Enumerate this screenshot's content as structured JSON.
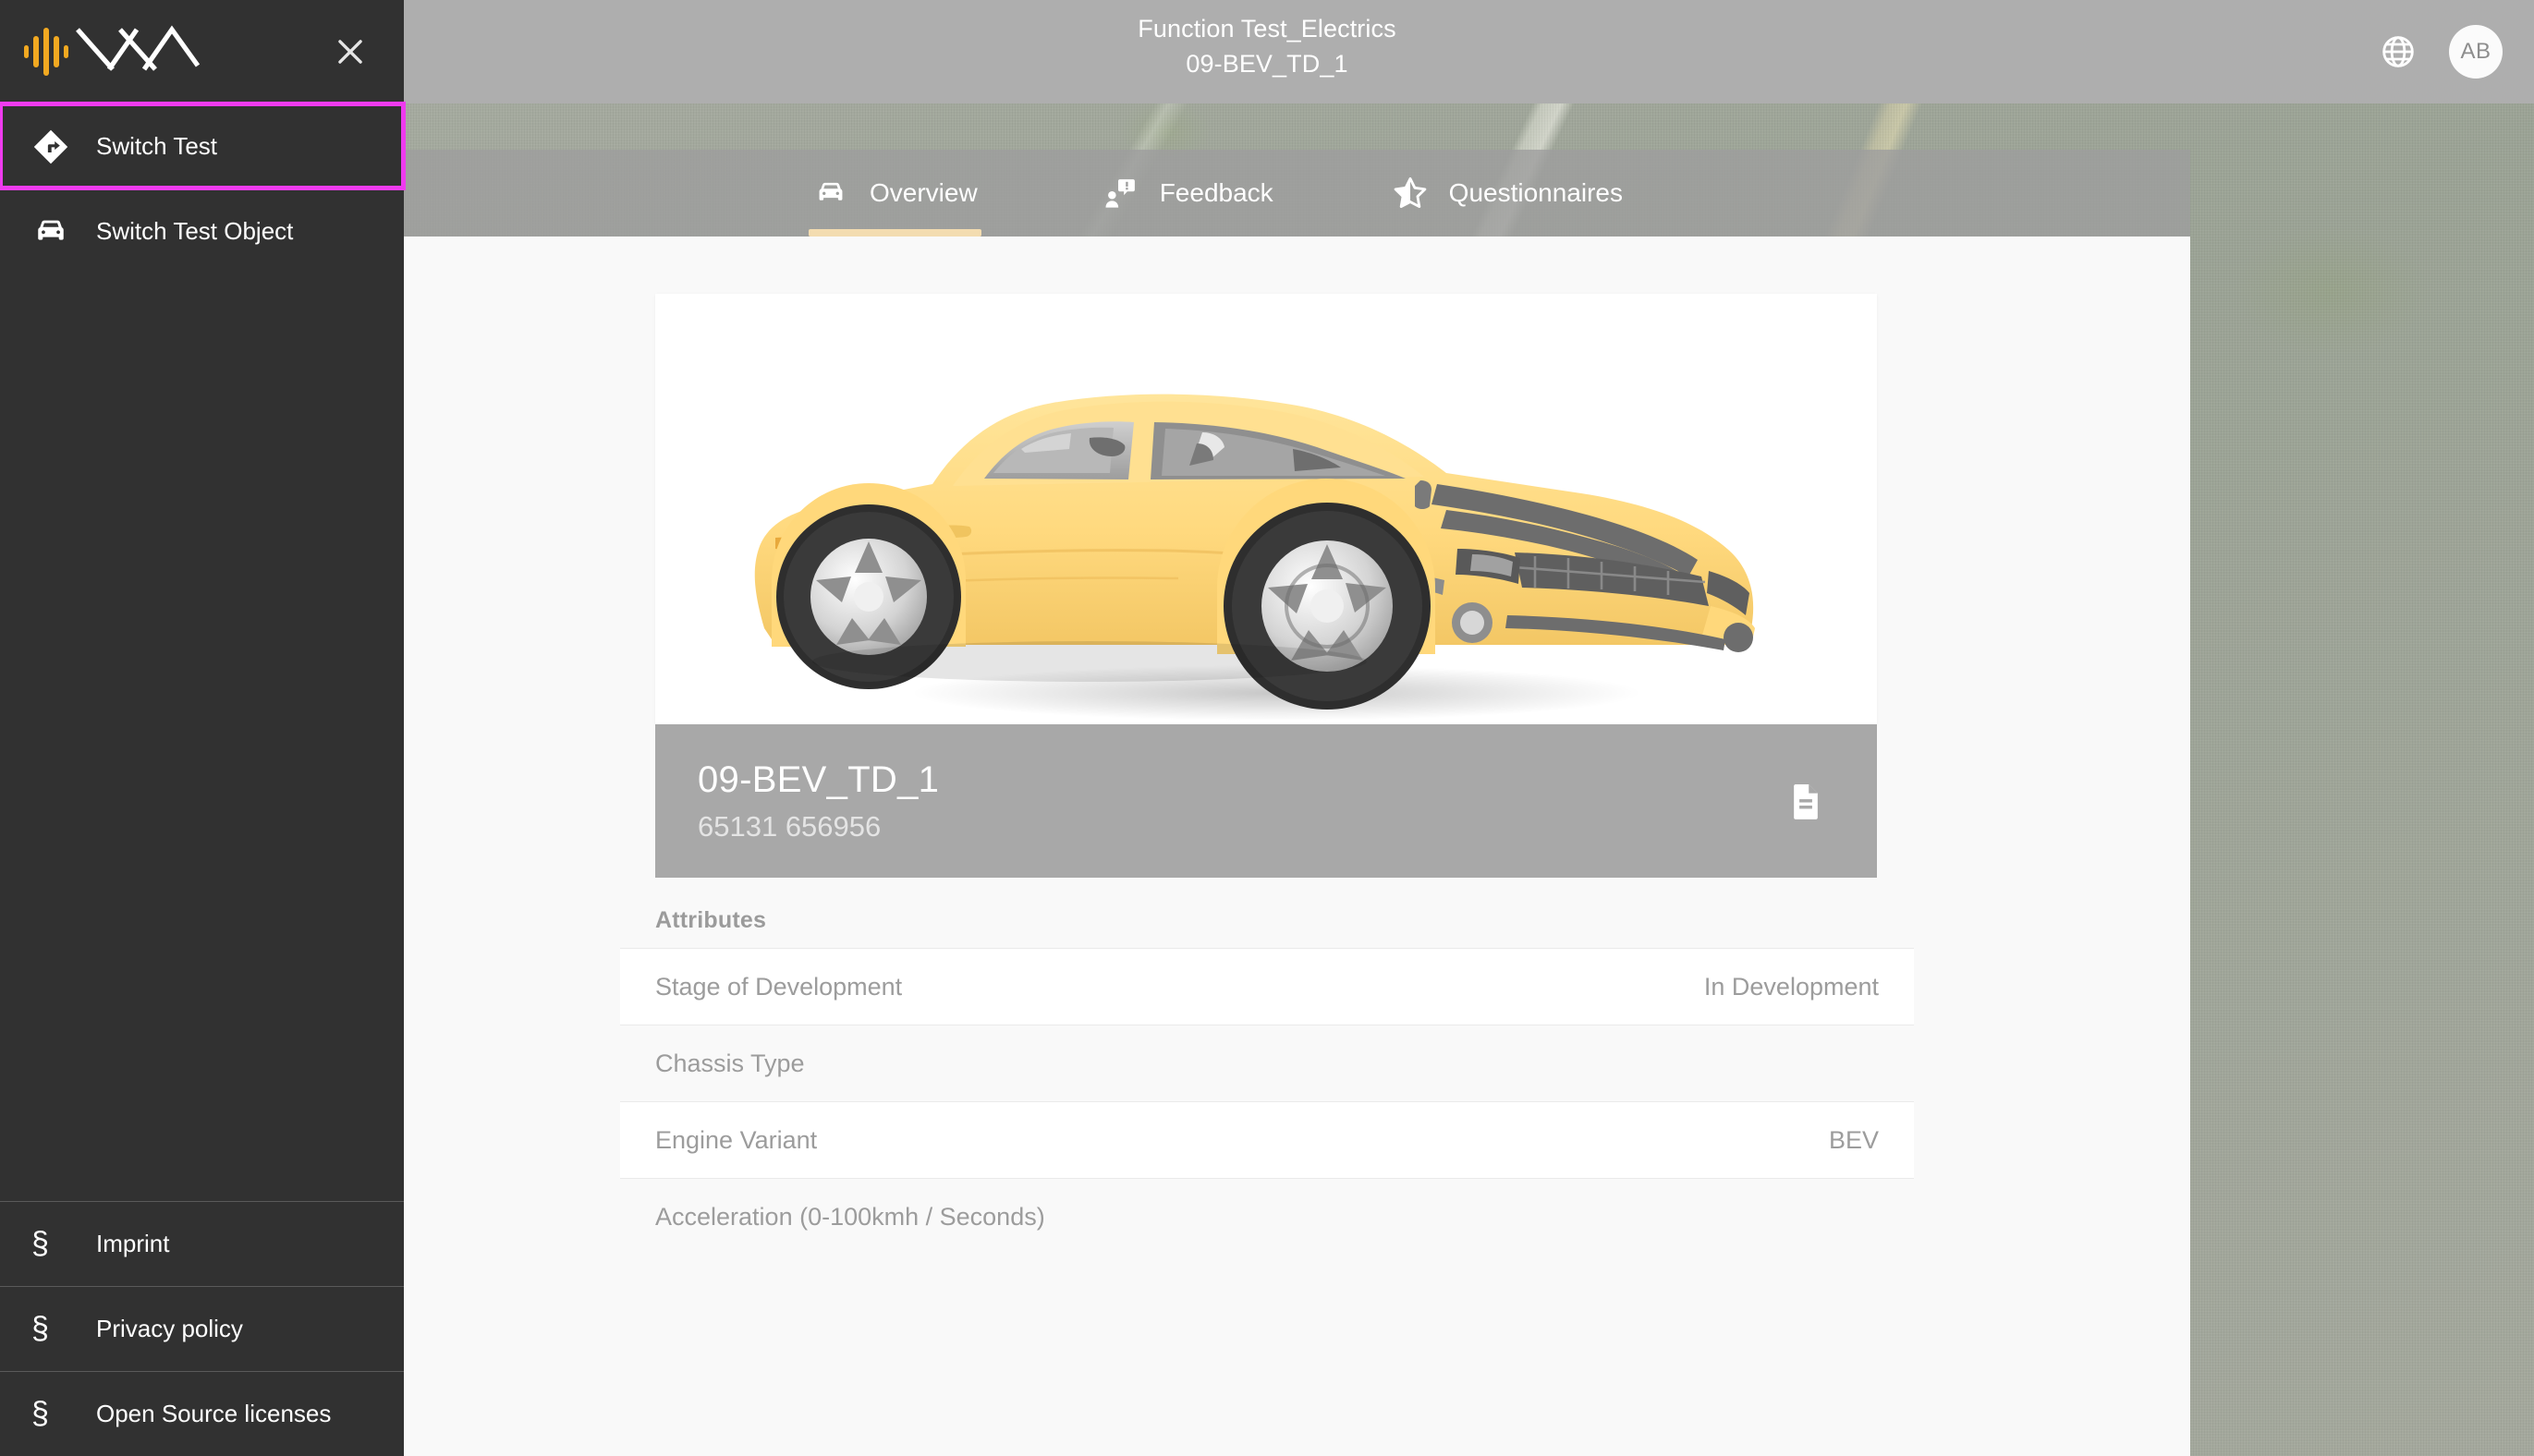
{
  "header": {
    "title_line1": "Function Test_Electrics",
    "title_line2": "09-BEV_TD_1",
    "language_icon": "globe-icon",
    "avatar_initials": "AB"
  },
  "tabs": [
    {
      "id": "overview",
      "label": "Overview",
      "icon": "car-front-icon",
      "active": true
    },
    {
      "id": "feedback",
      "label": "Feedback",
      "icon": "feedback-icon",
      "active": false
    },
    {
      "id": "questionnaires",
      "label": "Questionnaires",
      "icon": "star-half-icon",
      "active": false
    }
  ],
  "sidebar": {
    "logo_name": "app-logo",
    "close_label": "close-icon",
    "items": [
      {
        "id": "switch-test",
        "label": "Switch Test",
        "icon": "turn-right-diamond-icon",
        "highlighted": true
      },
      {
        "id": "switch-test-object",
        "label": "Switch Test Object",
        "icon": "car-front-icon",
        "highlighted": false
      }
    ],
    "legal": [
      {
        "id": "imprint",
        "label": "Imprint",
        "icon": "section-sign-icon"
      },
      {
        "id": "privacy-policy",
        "label": "Privacy policy",
        "icon": "section-sign-icon"
      },
      {
        "id": "open-source-licenses",
        "label": "Open Source licenses",
        "icon": "section-sign-icon"
      }
    ]
  },
  "vehicle": {
    "image_alt": "yellow-sports-car",
    "name": "09-BEV_TD_1",
    "number": "65131 656956",
    "document_icon": "document-icon"
  },
  "attributes": {
    "heading": "Attributes",
    "rows": [
      {
        "label": "Stage of Development",
        "value": "In Development"
      },
      {
        "label": "Chassis Type",
        "value": ""
      },
      {
        "label": "Engine Variant",
        "value": "BEV"
      },
      {
        "label": "Acceleration (0-100kmh / Seconds)",
        "value": ""
      }
    ]
  },
  "colors": {
    "sidebar_bg": "#313131",
    "highlight_outline": "#ef3bef",
    "header_bg": "#aeaeae",
    "tab_active_underline": "#f3dcb0",
    "logo_accent": "#f2a921",
    "panel_bg": "#f9f9f9",
    "band_bg": "#a8a8a8"
  }
}
